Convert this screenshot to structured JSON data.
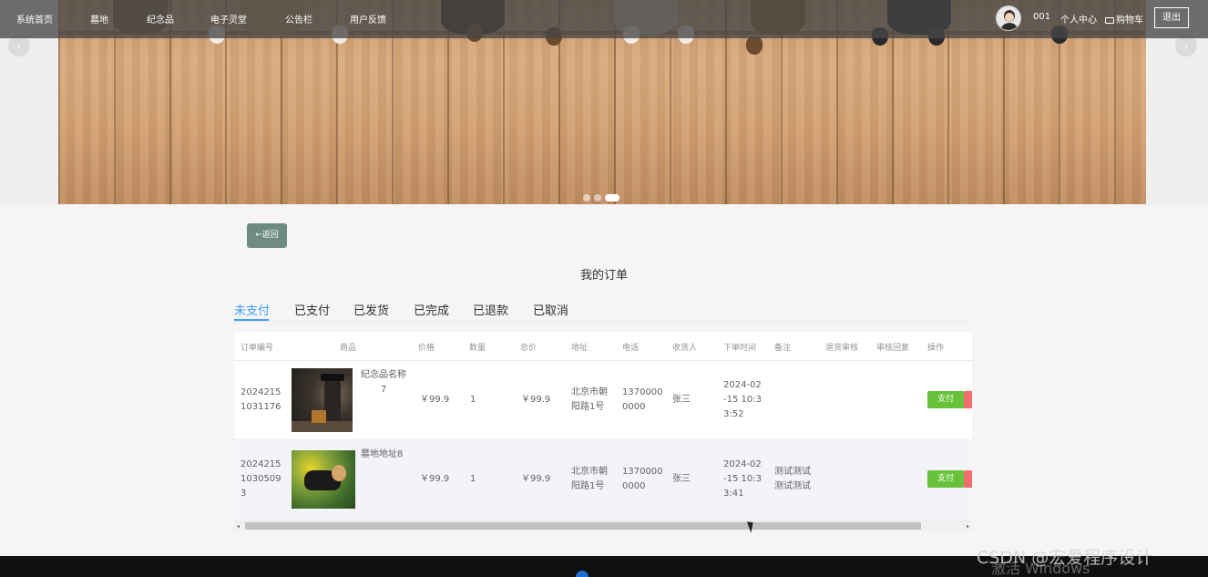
{
  "nav": {
    "items": [
      "系统首页",
      "墓地",
      "纪念品",
      "电子灵堂",
      "公告栏",
      "用户反馈"
    ],
    "username": "001",
    "profile": "个人中心",
    "cart": "购物车",
    "logout": "退出"
  },
  "banner": {
    "dots": 3,
    "active_dot": 3,
    "prev_arrow": "‹",
    "next_arrow": "›"
  },
  "back_button": "←返回",
  "page_title": "我的订单",
  "tabs": [
    "未支付",
    "已支付",
    "已发货",
    "已完成",
    "已退款",
    "已取消"
  ],
  "active_tab": 0,
  "table": {
    "headers": [
      "订单编号",
      "商品",
      "价格",
      "数量",
      "总价",
      "地址",
      "电话",
      "收货人",
      "下单时间",
      "备注",
      "退货审核",
      "审核回复",
      "操作"
    ],
    "rows": [
      {
        "order_no_lines": [
          "2024215",
          "1031176"
        ],
        "product_lines": [
          "纪念品名称",
          "7"
        ],
        "price": "￥99.9",
        "qty": "1",
        "total": "￥99.9",
        "address_lines": [
          "北京市朝",
          "阳路1号"
        ],
        "phone_lines": [
          "1370000",
          "0000"
        ],
        "receiver": "张三",
        "time_lines": [
          "2024-02",
          "-15 10:3",
          "3:52"
        ],
        "note_lines": [],
        "action": "支付"
      },
      {
        "order_no_lines": [
          "2024215",
          "1030509",
          "3"
        ],
        "product_lines": [
          "墓地地址8"
        ],
        "price": "￥99.9",
        "qty": "1",
        "total": "￥99.9",
        "address_lines": [
          "北京市朝",
          "阳路1号"
        ],
        "phone_lines": [
          "1370000",
          "0000"
        ],
        "receiver": "张三",
        "time_lines": [
          "2024-02",
          "-15 10:3",
          "3:41"
        ],
        "note_lines": [
          "测试测试",
          "测试测试"
        ],
        "action": "支付"
      }
    ]
  },
  "scrollbar": {
    "left_arrow": "◂",
    "right_arrow": "▸"
  },
  "watermarks": [
    "CSDN @宏爱程序设计",
    "激活 Windows"
  ]
}
